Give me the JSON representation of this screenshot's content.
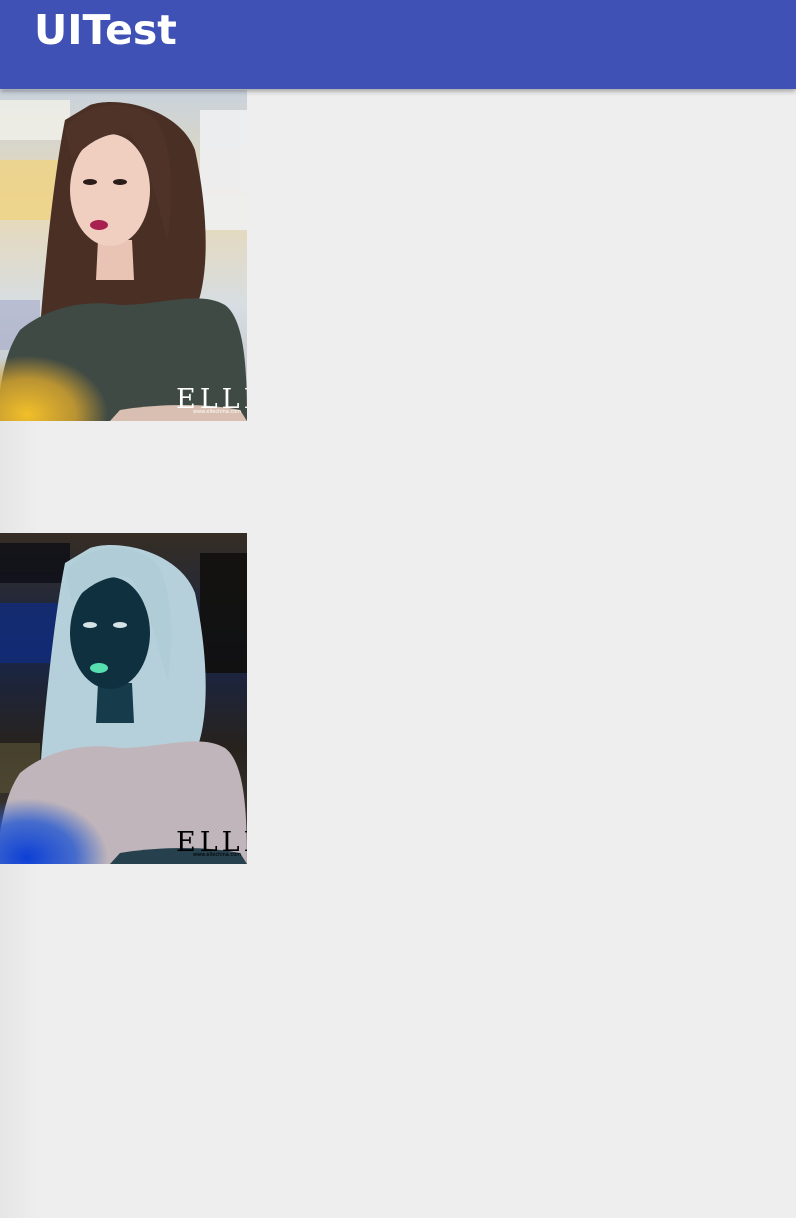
{
  "app_bar": {
    "title": "UITest",
    "color": "#3f51b5"
  },
  "images": [
    {
      "name": "portrait-photo",
      "filter": "normal",
      "watermark": "ELLE",
      "watermark_url": "www.ellechina.com"
    },
    {
      "name": "portrait-photo-inverted",
      "filter": "invert",
      "watermark": "ELLE",
      "watermark_url": "www.ellechina.com"
    }
  ]
}
